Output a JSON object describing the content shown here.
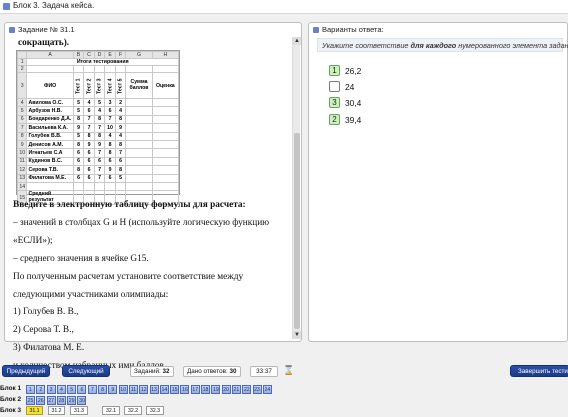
{
  "window": {
    "title": "Блок 3. Задача кейса."
  },
  "left_panel": {
    "title": "Задание № 31.1",
    "heading_tail": "сокращать).",
    "sheet": {
      "columns": [
        "A",
        "B",
        "C",
        "D",
        "E",
        "F",
        "G",
        "H"
      ],
      "title": "Итоги тестирования",
      "header": {
        "fio": "ФИО",
        "tests": [
          "Тест 1",
          "Тест 2",
          "Тест 3",
          "Тест 4",
          "Тест 5"
        ],
        "sum": "Сумма баллов",
        "grade": "Оценка"
      },
      "rows": [
        {
          "n": "4",
          "name": "Авилова О.С.",
          "scores": [
            "5",
            "4",
            "5",
            "3",
            "2"
          ]
        },
        {
          "n": "5",
          "name": "Арбузов Н.В.",
          "scores": [
            "5",
            "6",
            "4",
            "6",
            "4"
          ]
        },
        {
          "n": "6",
          "name": "Бондаренко Д.А.",
          "scores": [
            "8",
            "7",
            "8",
            "7",
            "8"
          ]
        },
        {
          "n": "7",
          "name": "Васильева К.А.",
          "scores": [
            "9",
            "7",
            "7",
            "10",
            "9"
          ]
        },
        {
          "n": "8",
          "name": "Голубев В.В.",
          "scores": [
            "5",
            "8",
            "8",
            "4",
            "4"
          ]
        },
        {
          "n": "9",
          "name": "Денисов А.М.",
          "scores": [
            "8",
            "9",
            "9",
            "8",
            "8"
          ]
        },
        {
          "n": "10",
          "name": "Игнатьев С.А",
          "scores": [
            "6",
            "6",
            "7",
            "8",
            "7"
          ]
        },
        {
          "n": "11",
          "name": "Кудинов В.С.",
          "scores": [
            "6",
            "6",
            "6",
            "6",
            "6"
          ]
        },
        {
          "n": "12",
          "name": "Серова Т.В.",
          "scores": [
            "8",
            "6",
            "7",
            "9",
            "8"
          ]
        },
        {
          "n": "13",
          "name": "Филатова М.Е.",
          "scores": [
            "6",
            "6",
            "7",
            "6",
            "5"
          ]
        }
      ],
      "empty_row_n": "14",
      "avg_row_n": "15",
      "avg_label": "Средний результат"
    },
    "text_lines": [
      "Введите в электронную таблицу формулы для расчета:",
      "– значений в столбцах G и H (используйте логическую функцию",
      "«ЕСЛИ»);",
      "– среднего значения в ячейке G15.",
      "По полученным расчетам установите соответствие между",
      "следующими участниками олимпиады:",
      "1) Голубев В. В.,",
      "2) Серова Т. В.,",
      "3) Филатова М. Е.",
      "и количеством набранных ими баллов."
    ]
  },
  "right_panel": {
    "title": "Варианты ответа:",
    "hint_prefix": "Укажите соответствие ",
    "hint_bold": "для каждого",
    "hint_suffix": " нумерованного элемента задания",
    "options": [
      {
        "mark": "1",
        "value": "26,2"
      },
      {
        "mark": "",
        "value": "24"
      },
      {
        "mark": "3",
        "value": "30,4"
      },
      {
        "mark": "2",
        "value": "39,4"
      }
    ]
  },
  "footer": {
    "prev_label": "Предыдущий",
    "next_label": "Следующий",
    "tasks_label": "Заданий:",
    "tasks_value": "32",
    "answered_label": "Дано ответов:",
    "answered_value": "30",
    "timer": "33:37",
    "finish_label": "Завершить тестир",
    "block1_label": "Блок 1",
    "block2_label": "Блок 2",
    "block3_label": "Блок 3",
    "block1_numbers": [
      "1",
      "2",
      "3",
      "4",
      "5",
      "6",
      "7",
      "8",
      "9",
      "10",
      "11",
      "12",
      "13",
      "14",
      "15",
      "16",
      "17",
      "18",
      "19",
      "20",
      "21",
      "22",
      "23",
      "24"
    ],
    "block2_numbers": [
      "25",
      "26",
      "27",
      "28",
      "29",
      "30"
    ],
    "block3_items": [
      "31.1",
      "31.2",
      "31.3",
      "32.1",
      "32.2",
      "32.3"
    ]
  }
}
